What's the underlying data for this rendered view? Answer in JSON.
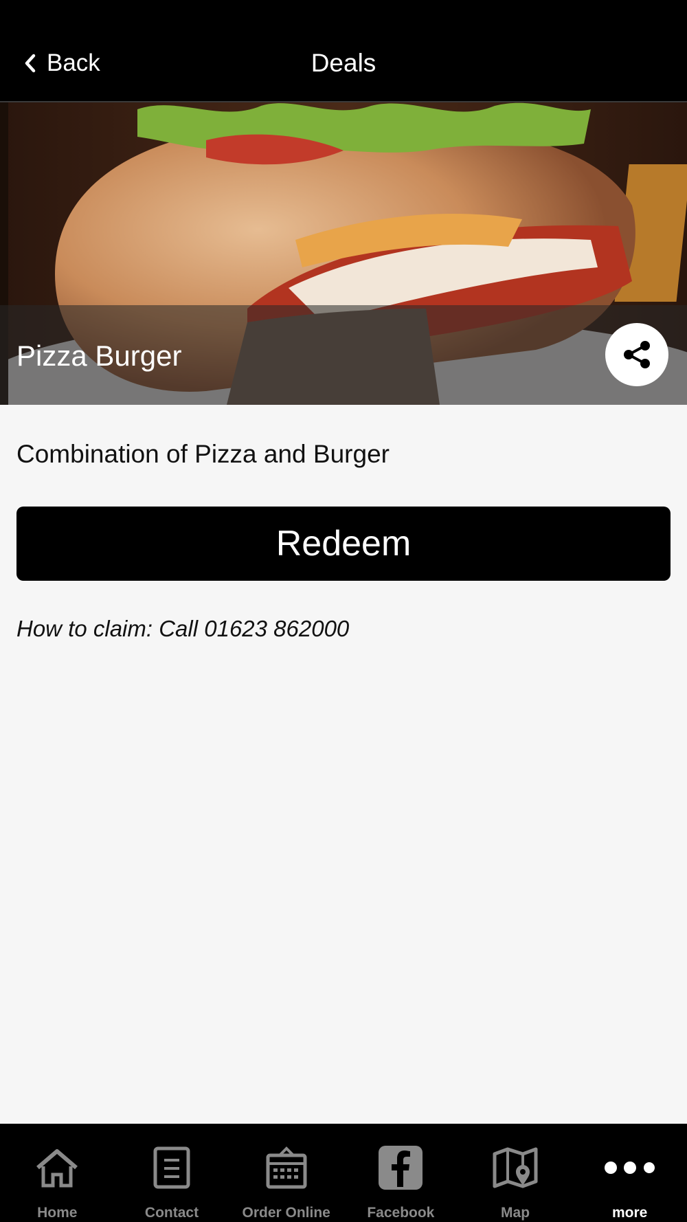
{
  "nav": {
    "back_label": "Back",
    "title": "Deals"
  },
  "deal": {
    "name": "Pizza Burger",
    "description": "Combination of Pizza and Burger",
    "redeem_label": "Redeem",
    "claim_text": "How to claim: Call 01623 862000"
  },
  "tabs": [
    {
      "label": "Home",
      "icon": "home-icon"
    },
    {
      "label": "Contact",
      "icon": "contact-icon"
    },
    {
      "label": "Order Online",
      "icon": "order-online-icon"
    },
    {
      "label": "Facebook",
      "icon": "facebook-icon"
    },
    {
      "label": "Map",
      "icon": "map-icon"
    },
    {
      "label": "more",
      "icon": "more-icon",
      "active": true
    }
  ],
  "colors": {
    "nav_bg": "#000000",
    "page_bg": "#f6f6f6",
    "button_bg": "#000000",
    "tab_inactive": "#8a8a8a",
    "tab_active": "#ffffff"
  }
}
